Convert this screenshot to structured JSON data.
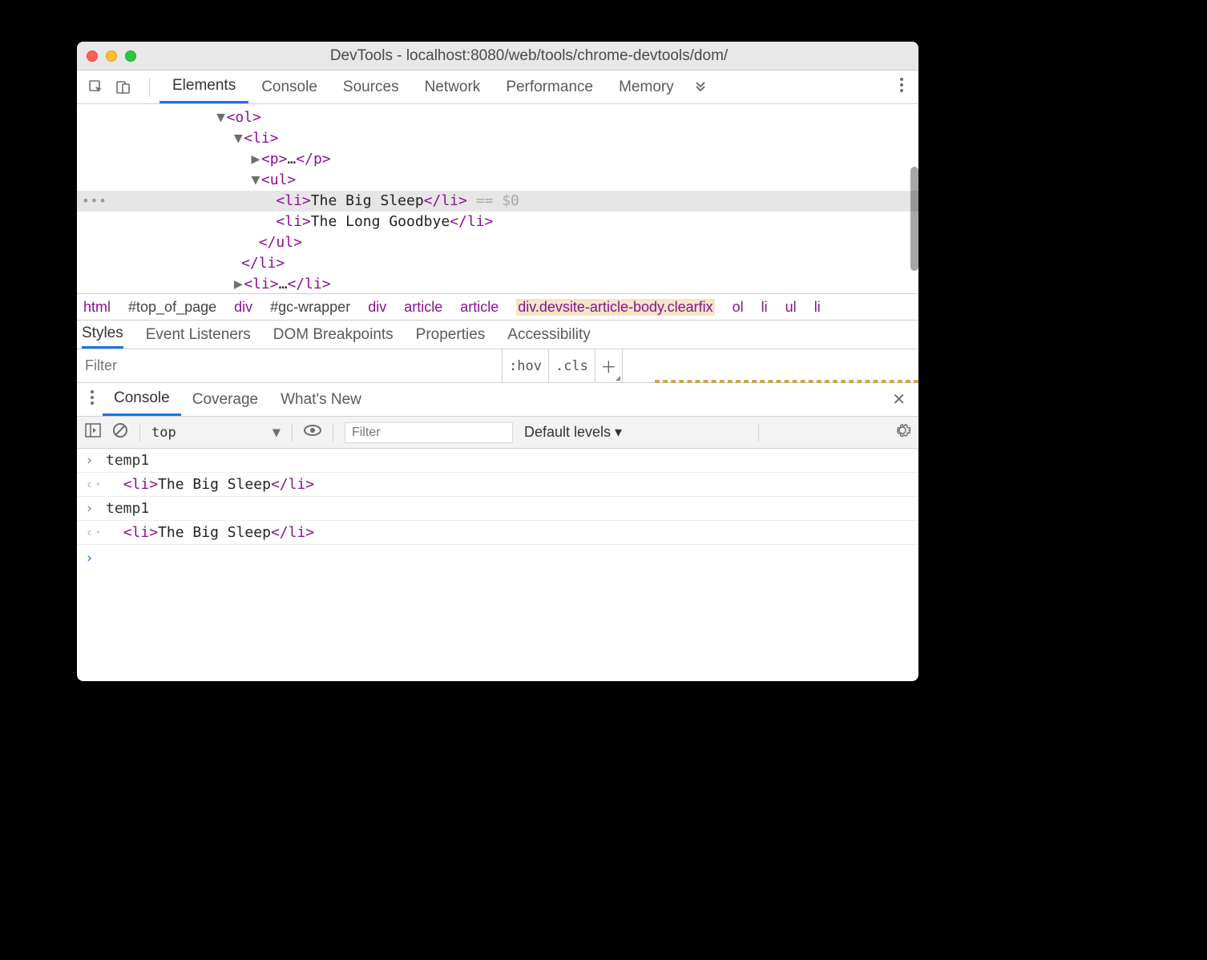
{
  "window": {
    "title": "DevTools - localhost:8080/web/tools/chrome-devtools/dom/"
  },
  "main_tabs": {
    "elements": "Elements",
    "console": "Console",
    "sources": "Sources",
    "network": "Network",
    "performance": "Performance",
    "memory": "Memory"
  },
  "dom": {
    "ol_open": "<ol>",
    "li_open": "<li>",
    "p_collapsed": "<p>…</p>",
    "ul_open": "<ul>",
    "li1_open": "<li>",
    "li1_text": "The Big Sleep",
    "li1_close": "</li>",
    "eq0": " == $0",
    "li2_open": "<li>",
    "li2_text": "The Long Goodbye",
    "li2_close": "</li>",
    "ul_close": "</ul>",
    "li_close": "</li>",
    "li3_collapsed": "<li>…</li>"
  },
  "breadcrumb": {
    "html": "html",
    "top": "#top_of_page",
    "div1": "div",
    "gc": "#gc-wrapper",
    "div2": "div",
    "article1": "article",
    "article2": "article",
    "devsite": "div.devsite-article-body.clearfix",
    "ol": "ol",
    "li1": "li",
    "ul": "ul",
    "li2": "li"
  },
  "subtabs": {
    "styles": "Styles",
    "listeners": "Event Listeners",
    "dombp": "DOM Breakpoints",
    "props": "Properties",
    "a11y": "Accessibility"
  },
  "filterbar": {
    "filter_ph": "Filter",
    "hov": ":hov",
    "cls": ".cls"
  },
  "drawer_tabs": {
    "console": "Console",
    "coverage": "Coverage",
    "whatsnew": "What's New"
  },
  "console_tb": {
    "context": "top",
    "filter_ph": "Filter",
    "levels": "Default levels ▾"
  },
  "console": {
    "rows": [
      {
        "icon": "prompt",
        "text": "temp1"
      },
      {
        "icon": "ret",
        "li_open": "<li>",
        "body": "The Big Sleep",
        "li_close": "</li>"
      },
      {
        "icon": "prompt",
        "text": "temp1"
      },
      {
        "icon": "ret",
        "li_open": "<li>",
        "body": "The Big Sleep",
        "li_close": "</li>"
      }
    ]
  }
}
